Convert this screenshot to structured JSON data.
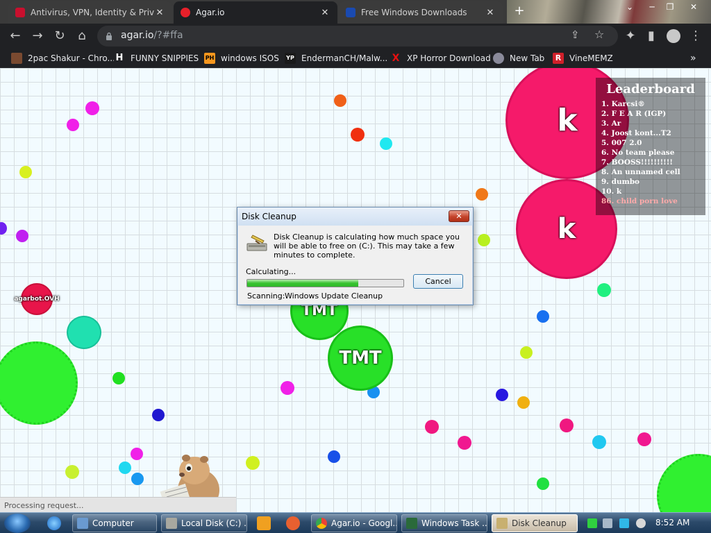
{
  "browser": {
    "tabs": [
      {
        "title": "Antivirus, VPN, Identity & Privac",
        "favicon_color": "#c8102e"
      },
      {
        "title": "Agar.io",
        "favicon_color": "#e8202a"
      },
      {
        "title": "Free Windows Downloads",
        "favicon_color": "#1a4ab0"
      }
    ],
    "new_tab": "+",
    "url_host": "agar.io",
    "url_rest": "/?#ffa"
  },
  "bookmarks": [
    {
      "label": "2pac Shakur - Chro...",
      "icon": "person-icon",
      "color": "#7a4a30"
    },
    {
      "label": "FUNNY SNIPPIES",
      "icon": "H",
      "color": "#333333"
    },
    {
      "label": "windows ISOS",
      "icon": "PH",
      "color": "#f7971d"
    },
    {
      "label": "EndermanCH/Malw...",
      "icon": "YP",
      "color": "#1a1a1a"
    },
    {
      "label": "XP Horror Download",
      "icon": "X",
      "color": "#e81010"
    },
    {
      "label": "New Tab",
      "icon": "globe-icon",
      "color": "#8a8a9a"
    },
    {
      "label": "VineMEMZ",
      "icon": "R",
      "color": "#d0202a"
    }
  ],
  "game": {
    "cells": [
      {
        "name": "k",
        "color": "#f51a6a"
      },
      {
        "name": "k",
        "color": "#f51a6a"
      },
      {
        "name": "TMT",
        "color": "#28e028"
      },
      {
        "name": "TMT",
        "color": "#28e028"
      },
      {
        "name": "agarbot.OVH",
        "color": "#e8154a"
      }
    ],
    "leaderboard": {
      "title": "Leaderboard",
      "rows": [
        "1. Karcsi®",
        "2. F E A R (IGP)",
        "3. Ar",
        "4. Joost kont...T2",
        "5. 007 2.0",
        "6. No team please",
        "7. BOOSS!!!!!!!!!!",
        "8. An unnamed cell",
        "9. dumbo",
        "10. k",
        "86. child porn love"
      ]
    }
  },
  "dialog": {
    "title": "Disk Cleanup",
    "close": "✕",
    "message": "Disk Cleanup is calculating how much space you will be able to free on  (C:). This may take a few minutes to complete.",
    "calculating": "Calculating...",
    "progress": 0.71,
    "cancel": "Cancel",
    "scanning_label": "Scanning:",
    "scanning_value": "Windows Update Cleanup"
  },
  "status_bar": "Processing request...",
  "taskbar": {
    "buttons": [
      {
        "label": "Computer"
      },
      {
        "label": "Local Disk (C:) ..."
      },
      {
        "label": "Agar.io - Googl..."
      },
      {
        "label": "Windows Task ..."
      },
      {
        "label": "Disk Cleanup"
      }
    ],
    "clock": "8:52 AM"
  }
}
